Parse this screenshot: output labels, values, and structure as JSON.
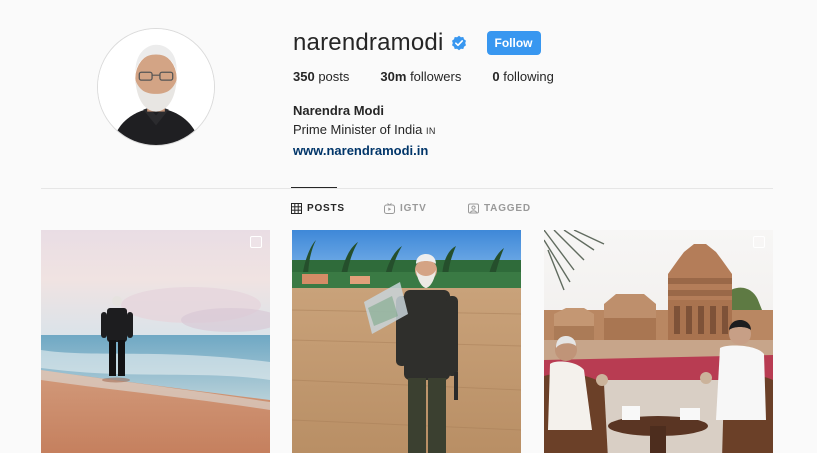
{
  "profile": {
    "username": "narendramodi",
    "verified_icon": "verified-badge-icon",
    "follow_label": "Follow",
    "posts_count": "350",
    "posts_label": "posts",
    "followers_count": "30m",
    "followers_label": "followers",
    "following_count": "0",
    "following_label": "following",
    "full_name": "Narendra Modi",
    "bio": "Prime Minister of India",
    "country_code": "IN",
    "website": "www.narendramodi.in"
  },
  "tabs": [
    {
      "label": "POSTS",
      "icon": "grid-icon",
      "active": true
    },
    {
      "label": "IGTV",
      "icon": "igtv-icon",
      "active": false
    },
    {
      "label": "TAGGED",
      "icon": "tagged-icon",
      "active": false
    }
  ],
  "posts": [
    {
      "scene": "man walking along beach at dusk",
      "multi": true
    },
    {
      "scene": "man holding bag of collected litter on beach",
      "multi": false
    },
    {
      "scene": "two leaders seated before stone temple",
      "multi": true
    }
  ],
  "colors": {
    "accent": "#3897f0",
    "link": "#003569",
    "background": "#fafafa",
    "divider": "#e6e6e6"
  }
}
